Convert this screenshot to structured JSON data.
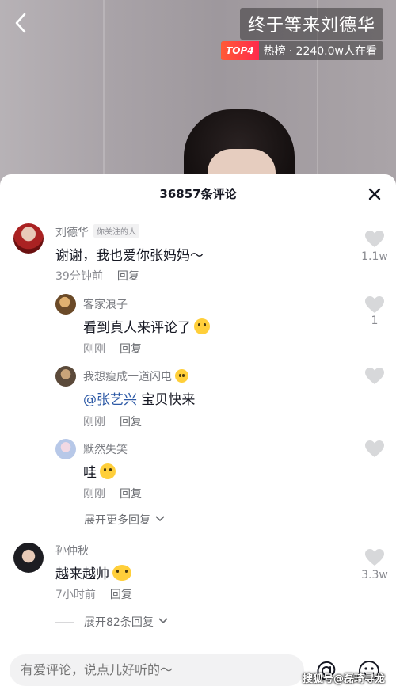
{
  "video": {
    "title": "终于等来刘德华",
    "hot_badge": "TOP4",
    "hot_label": "热榜",
    "viewers": "· 2240.0w人在看"
  },
  "sheet": {
    "count_title": "36857条评论"
  },
  "comments": [
    {
      "user": "刘德华",
      "tag": "你关注的人",
      "text": "谢谢，我也爱你张妈妈～",
      "time": "39分钟前",
      "reply": "回复",
      "likes": "1.1w"
    },
    {
      "user": "客家浪子",
      "text": "看到真人来评论了",
      "emoji": "laughing-crying-emoji",
      "time": "刚刚",
      "reply": "回复",
      "likes": "1"
    },
    {
      "user": "我想瘦成一道闪电",
      "mention": "@张艺兴",
      "text": "宝贝快来",
      "time": "刚刚",
      "reply": "回复"
    },
    {
      "user": "默然失笑",
      "text": "哇",
      "time": "刚刚",
      "reply": "回复"
    },
    {
      "user": "孙仲秋",
      "text": "越来越帅",
      "time": "7小时前",
      "reply": "回复",
      "likes": "3.3w"
    }
  ],
  "expand_more": "展开更多回复",
  "expand_82": "展开82条回复",
  "input": {
    "placeholder": "有爱评论，说点儿好听的～"
  },
  "watermark": "搜狐号@磊琦寻龙",
  "colors": {
    "mention": "#2e5aa6",
    "hot_badge": "#ff3b3f",
    "text_primary": "#161823",
    "text_secondary": "#8a8b91"
  }
}
